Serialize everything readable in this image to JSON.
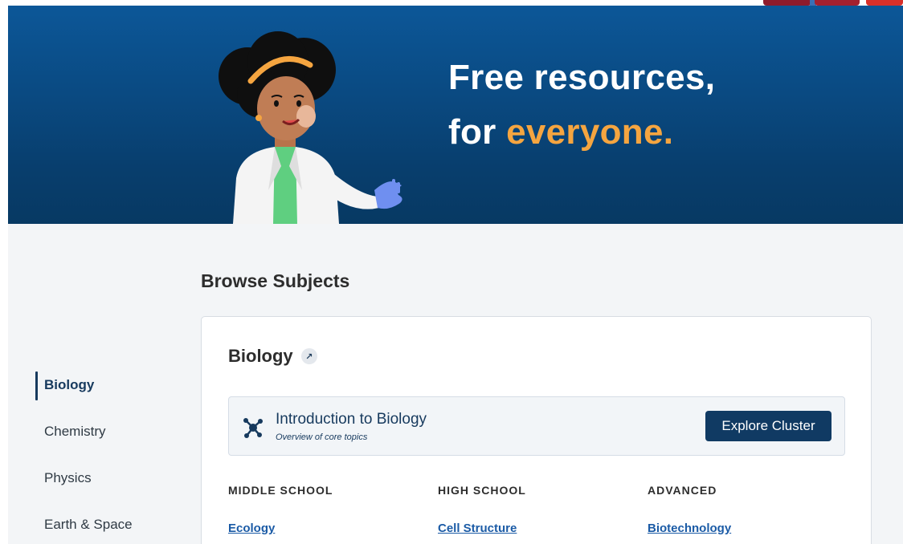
{
  "hero": {
    "title_line1": "Free resources,",
    "title_line2_prefix": "for ",
    "title_line2_accent": "everyone."
  },
  "browse": {
    "title": "Browse Subjects"
  },
  "sidebar": {
    "items": [
      {
        "label": "Biology",
        "active": true
      },
      {
        "label": "Chemistry",
        "active": false
      },
      {
        "label": "Physics",
        "active": false
      },
      {
        "label": "Earth & Space",
        "active": false
      }
    ]
  },
  "subject_card": {
    "title": "Biology",
    "external_link_icon": "arrow-up-right-icon",
    "cluster": {
      "icon": "molecule-icon",
      "title": "Introduction to Biology",
      "subtitle": "Overview of core topics",
      "button_label": "Explore Cluster"
    },
    "levels": [
      {
        "label": "MIDDLE SCHOOL",
        "topic": "Ecology"
      },
      {
        "label": "HIGH SCHOOL",
        "topic": "Cell Structure"
      },
      {
        "label": "ADVANCED",
        "topic": "Biotechnology"
      }
    ]
  },
  "colors": {
    "hero_bg": "#0a4a82",
    "accent": "#f5a540",
    "primary": "#103a63",
    "link": "#1b5ba6"
  }
}
